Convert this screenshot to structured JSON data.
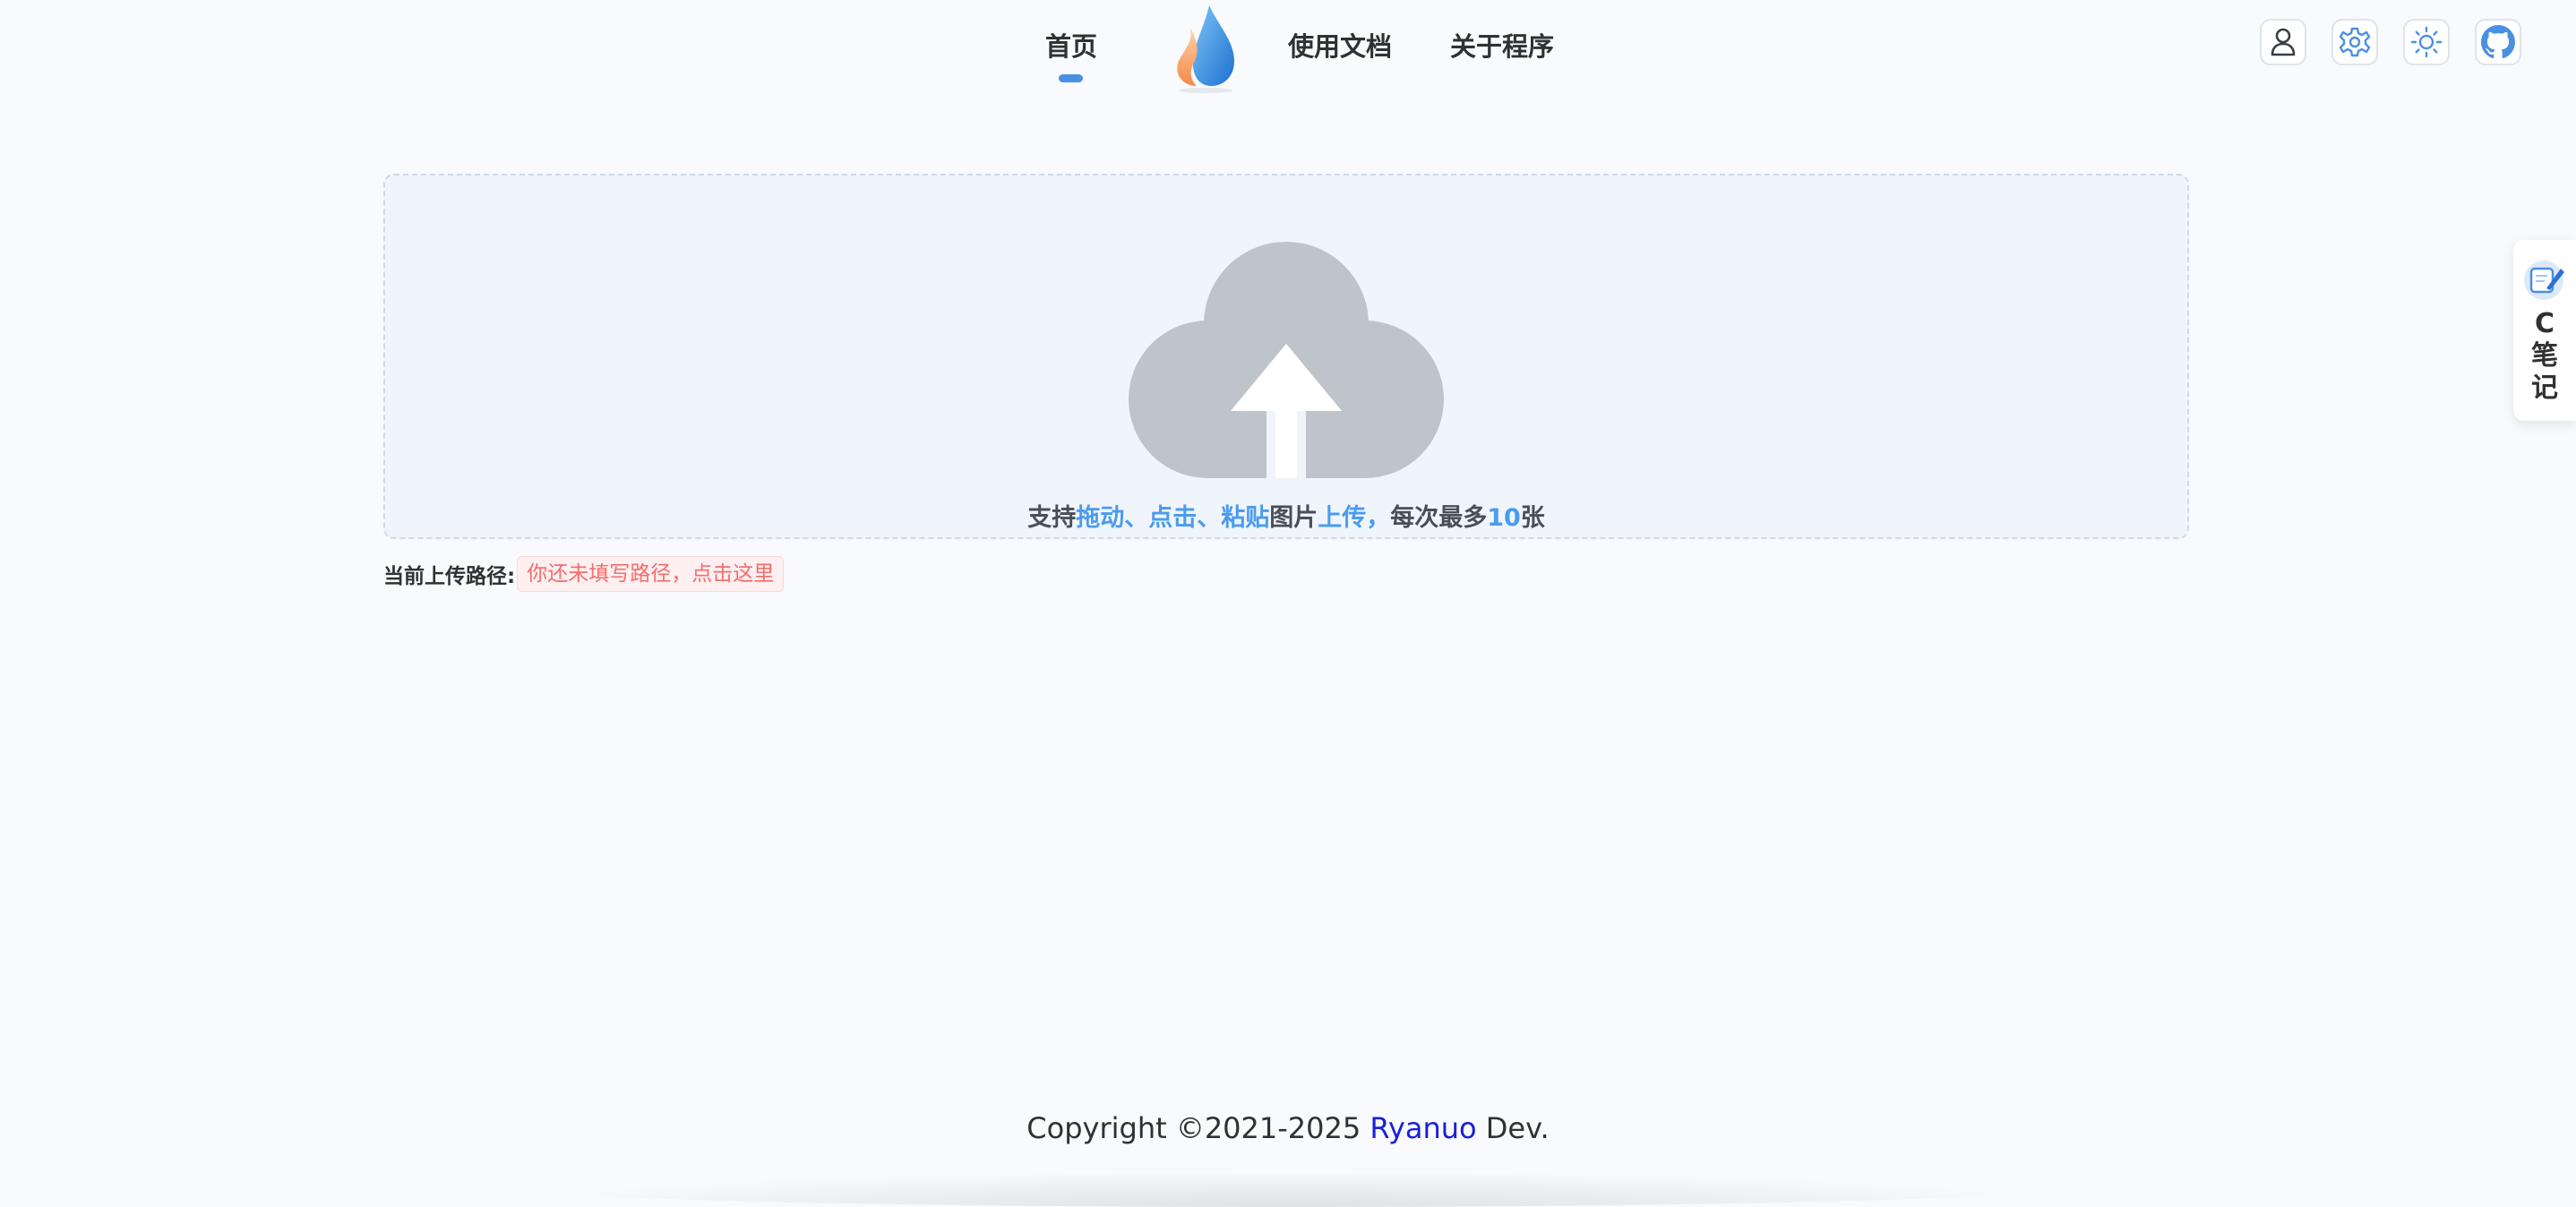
{
  "nav": {
    "home": "首页",
    "docs": "使用文档",
    "about": "关于程序"
  },
  "toolbar": {
    "icons": [
      "user-icon",
      "gear-icon",
      "sun-icon",
      "github-icon"
    ]
  },
  "upload": {
    "hint_1": "支持",
    "hint_2": "拖动、点击、粘贴",
    "hint_3": "图片",
    "hint_4": "上传，",
    "hint_5": "每次最多",
    "hint_6": "10",
    "hint_7": "张"
  },
  "path": {
    "label": "当前上传路径:",
    "tag": "你还未填写路径，点击这里"
  },
  "side_note": {
    "text": "C笔记"
  },
  "footer": {
    "prefix": "Copyright ©2021-2025 ",
    "author": "Ryanuo",
    "suffix": " Dev."
  },
  "colors": {
    "accent": "#4a9bf0",
    "warning": "#f56c6c",
    "author_link": "#1a1fd6"
  }
}
